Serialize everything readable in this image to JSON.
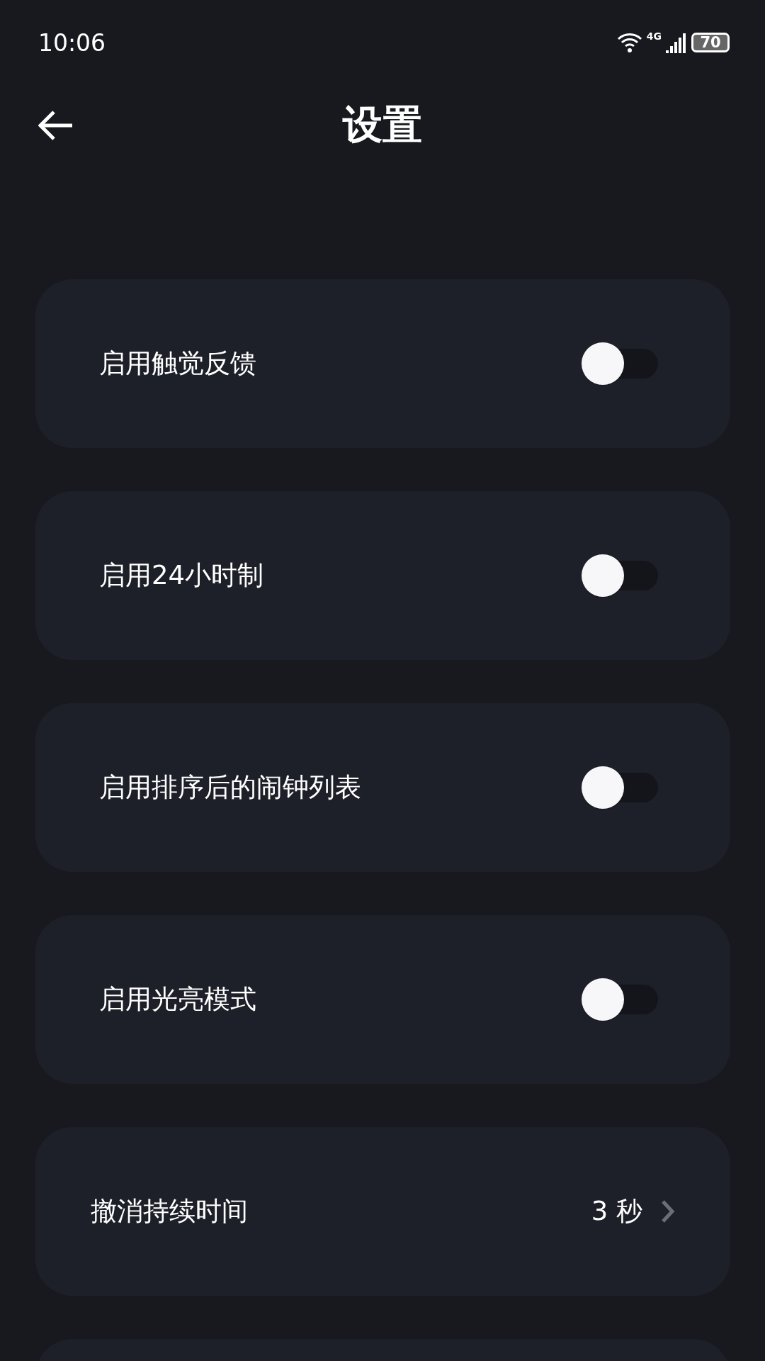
{
  "status_bar": {
    "time": "10:06",
    "network": "4G",
    "battery": "70"
  },
  "header": {
    "title": "设置"
  },
  "settings": [
    {
      "kind": "toggle",
      "label": "启用触觉反馈",
      "on": false
    },
    {
      "kind": "toggle",
      "label": "启用24小时制",
      "on": false
    },
    {
      "kind": "toggle",
      "label": "启用排序后的闹钟列表",
      "on": false
    },
    {
      "kind": "toggle",
      "label": "启用光亮模式",
      "on": false
    },
    {
      "kind": "value",
      "label": "撤消持续时间",
      "value": "3 秒"
    },
    {
      "kind": "empty"
    }
  ]
}
